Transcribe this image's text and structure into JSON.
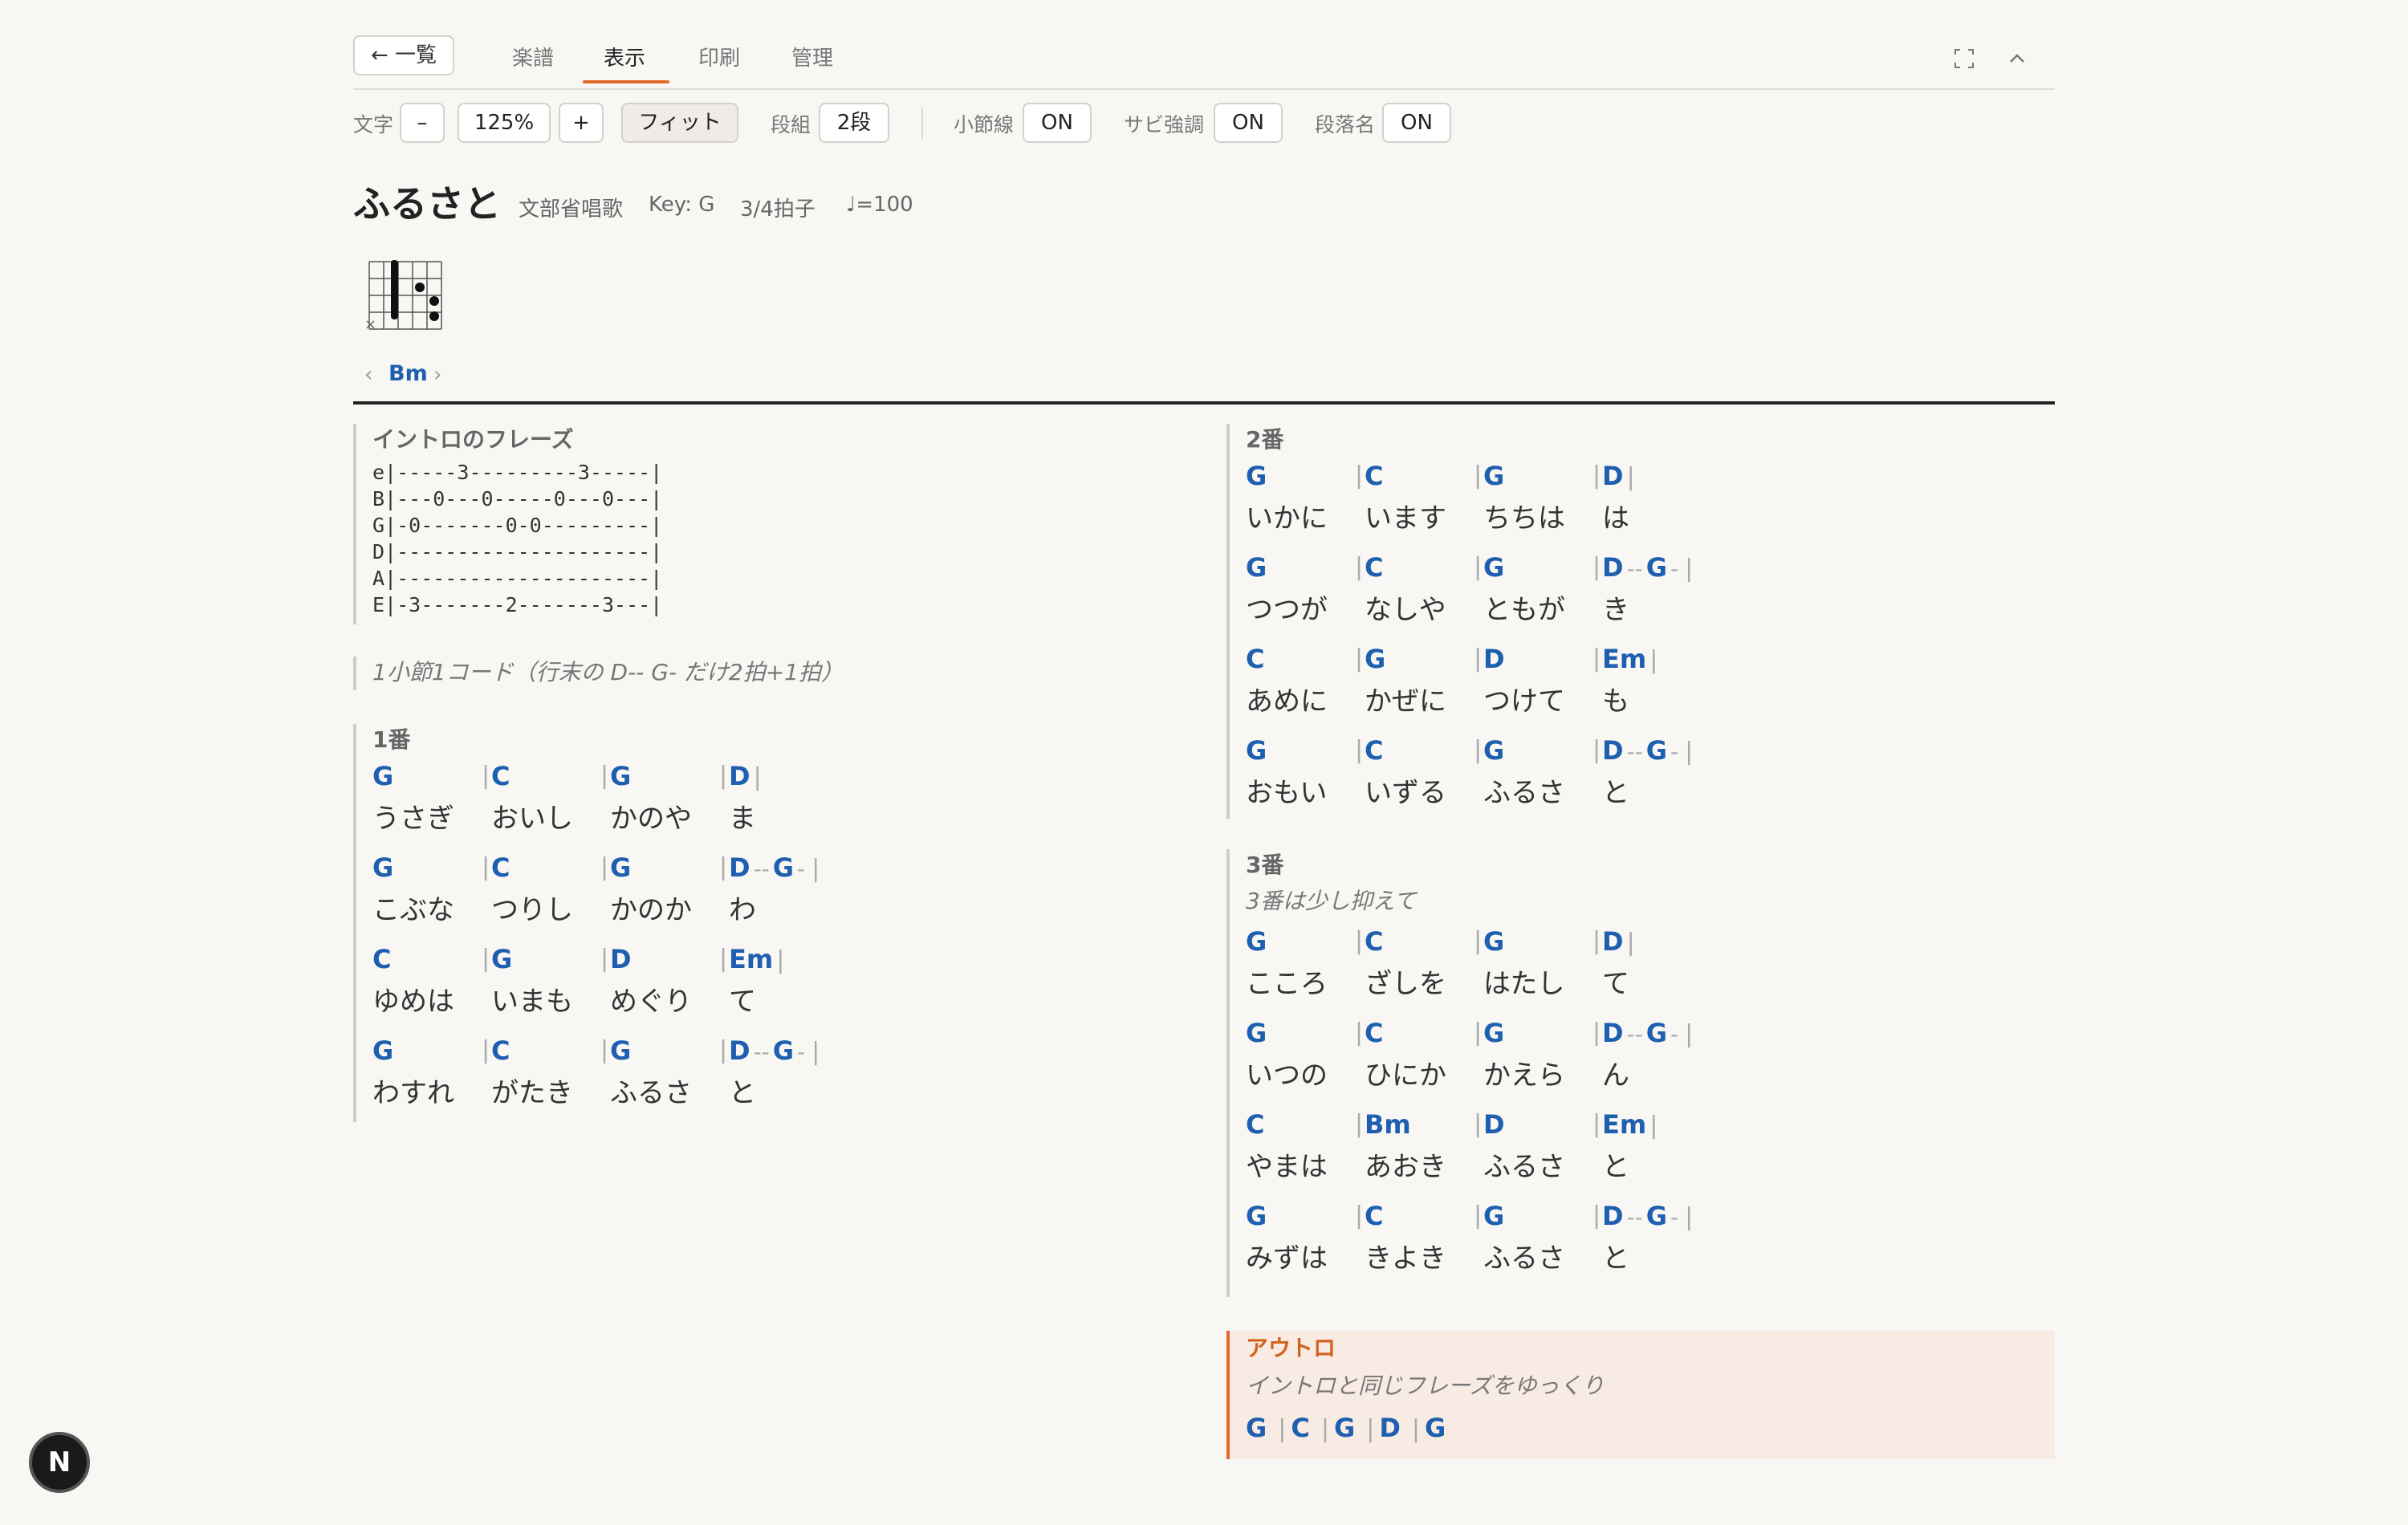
{
  "nav": {
    "back_label": "← 一覧",
    "tabs": [
      "楽譜",
      "表示",
      "印刷",
      "管理"
    ],
    "active_tab": "表示"
  },
  "toolbar": {
    "text_label": "文字",
    "minus": "–",
    "zoom": "125%",
    "plus": "+",
    "fit": "フィット",
    "columns_label": "段組",
    "columns_value": "2段",
    "barlines_label": "小節線",
    "barlines_value": "ON",
    "chorus_label": "サビ強調",
    "chorus_value": "ON",
    "section_label": "段落名",
    "section_value": "ON"
  },
  "song": {
    "title": "ふるさと",
    "composer": "文部省唱歌",
    "key": "Key: G",
    "time": "3/4拍子",
    "tempo": "♩=100"
  },
  "chord_picker": {
    "prev": "‹",
    "name": "Bm",
    "next": "›",
    "muted_string": "×"
  },
  "intro": {
    "title": "イントロのフレーズ",
    "tab": "e|-----3---------3-----|\nB|---0---0-----0---0---|\nG|-0-------0-0---------|\nD|---------------------|\nA|---------------------|\nE|-3-------2-------3---|",
    "note": "1小節1コード（行末の D-- G- だけ2拍+1拍）"
  },
  "verse1": {
    "title": "1番",
    "lines": [
      {
        "chords": [
          "G",
          "C",
          "G",
          "D"
        ],
        "lyrics": [
          "うさぎ",
          "おいし",
          "かのや",
          "ま"
        ]
      },
      {
        "chords": [
          "G",
          "C",
          "G",
          "D-- G-"
        ],
        "lyrics": [
          "こぶな",
          "つりし",
          "かのか",
          "わ"
        ]
      },
      {
        "chords": [
          "C",
          "G",
          "D",
          "Em"
        ],
        "lyrics": [
          "ゆめは",
          "いまも",
          "めぐり",
          "て"
        ]
      },
      {
        "chords": [
          "G",
          "C",
          "G",
          "D-- G-"
        ],
        "lyrics": [
          "わすれ",
          "がたき",
          "ふるさ",
          "と"
        ]
      }
    ]
  },
  "verse2": {
    "title": "2番",
    "lines": [
      {
        "chords": [
          "G",
          "C",
          "G",
          "D"
        ],
        "lyrics": [
          "いかに",
          "います",
          "ちちは",
          "は"
        ]
      },
      {
        "chords": [
          "G",
          "C",
          "G",
          "D-- G-"
        ],
        "lyrics": [
          "つつが",
          "なしや",
          "ともが",
          "き"
        ]
      },
      {
        "chords": [
          "C",
          "G",
          "D",
          "Em"
        ],
        "lyrics": [
          "あめに",
          "かぜに",
          "つけて",
          "も"
        ]
      },
      {
        "chords": [
          "G",
          "C",
          "G",
          "D-- G-"
        ],
        "lyrics": [
          "おもい",
          "いずる",
          "ふるさ",
          "と"
        ]
      }
    ]
  },
  "verse3": {
    "title": "3番",
    "note": "3番は少し抑えて",
    "lines": [
      {
        "chords": [
          "G",
          "C",
          "G",
          "D"
        ],
        "lyrics": [
          "こころ",
          "ざしを",
          "はたし",
          "て"
        ]
      },
      {
        "chords": [
          "G",
          "C",
          "G",
          "D-- G-"
        ],
        "lyrics": [
          "いつの",
          "ひにか",
          "かえら",
          "ん"
        ]
      },
      {
        "chords": [
          "C",
          "Bm",
          "D",
          "Em"
        ],
        "lyrics": [
          "やまは",
          "あおき",
          "ふるさ",
          "と"
        ]
      },
      {
        "chords": [
          "G",
          "C",
          "G",
          "D-- G-"
        ],
        "lyrics": [
          "みずは",
          "きよき",
          "ふるさ",
          "と"
        ]
      }
    ]
  },
  "outro": {
    "title": "アウトロ",
    "note": "イントロと同じフレーズをゆっくり",
    "chords": [
      "G",
      "C",
      "G",
      "D",
      "G"
    ]
  },
  "badge": "N",
  "colors": {
    "accent": "#e26a2c",
    "chord": "#1e5fb0",
    "outro_bg": "#f8ebe3"
  },
  "icons": {
    "expand": "expand-icon",
    "collapse": "chevron-up-icon"
  }
}
